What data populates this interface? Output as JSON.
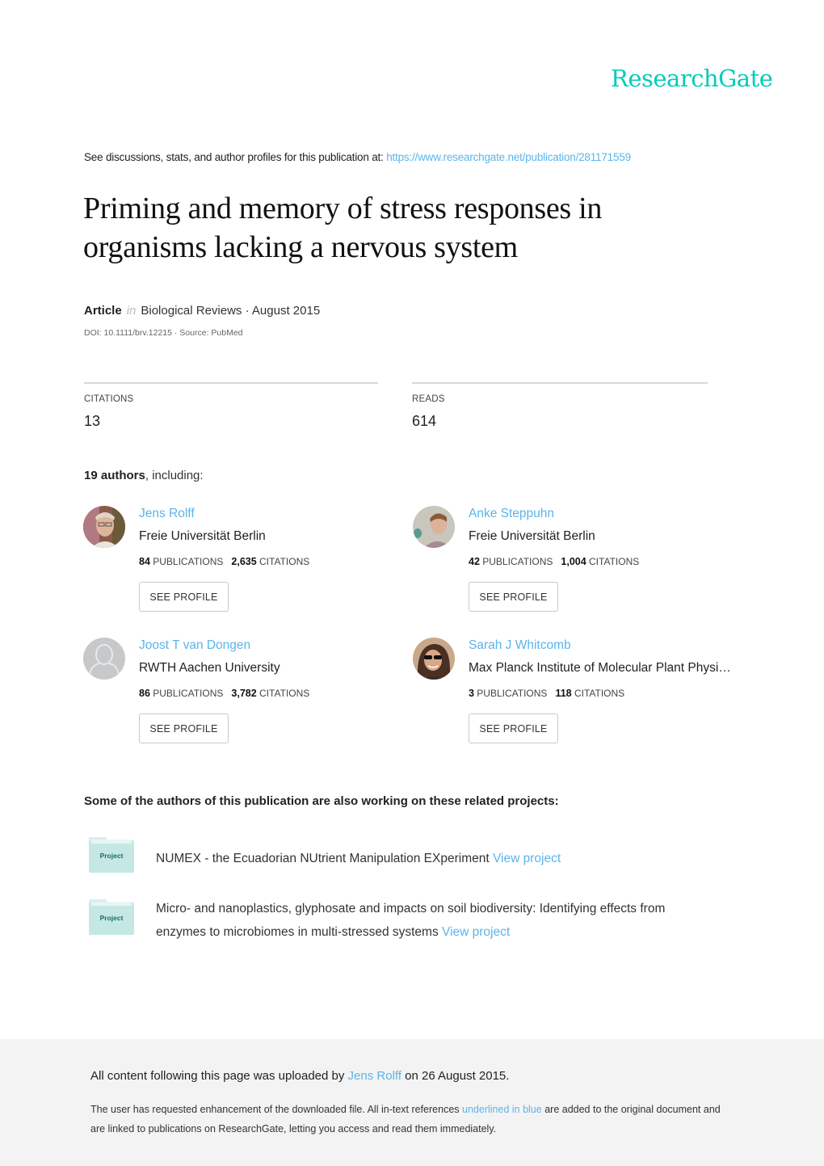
{
  "brand": {
    "logo_text": "ResearchGate",
    "accent_color": "#00ccbb",
    "link_color": "#5bb4ea"
  },
  "header": {
    "see_discussions_text": "See discussions, stats, and author profiles for this publication at:",
    "publication_url": "https://www.researchgate.net/publication/281171559"
  },
  "publication": {
    "title": "Priming and memory of stress responses in organisms lacking a nervous system",
    "type": "Article",
    "in_word": "in",
    "journal_date": "Biological Reviews · August 2015",
    "doi_source": "DOI: 10.1111/brv.12215 · Source: PubMed"
  },
  "stats": {
    "citations_label": "CITATIONS",
    "citations_value": "13",
    "reads_label": "READS",
    "reads_value": "614"
  },
  "authors_section": {
    "count_bold": "19 authors",
    "count_rest": ", including:",
    "authors": [
      {
        "name": "Jens Rolff",
        "institution": "Freie Universität Berlin",
        "publications": "84",
        "publications_label": "PUBLICATIONS",
        "citations": "2,635",
        "citations_label": "CITATIONS",
        "button": "SEE PROFILE",
        "avatar": "photo"
      },
      {
        "name": "Anke Steppuhn",
        "institution": "Freie Universität Berlin",
        "publications": "42",
        "publications_label": "PUBLICATIONS",
        "citations": "1,004",
        "citations_label": "CITATIONS",
        "button": "SEE PROFILE",
        "avatar": "photo"
      },
      {
        "name": "Joost T van Dongen",
        "institution": "RWTH Aachen University",
        "publications": "86",
        "publications_label": "PUBLICATIONS",
        "citations": "3,782",
        "citations_label": "CITATIONS",
        "button": "SEE PROFILE",
        "avatar": "placeholder"
      },
      {
        "name": "Sarah J Whitcomb",
        "institution": "Max Planck Institute of Molecular Plant Physi…",
        "publications": "3",
        "publications_label": "PUBLICATIONS",
        "citations": "118",
        "citations_label": "CITATIONS",
        "button": "SEE PROFILE",
        "avatar": "photo"
      }
    ]
  },
  "projects_section": {
    "heading": "Some of the authors of this publication are also working on these related projects:",
    "icon_label": "Project",
    "projects": [
      {
        "title": "NUMEX - the Ecuadorian NUtrient Manipulation EXperiment",
        "link": "View project"
      },
      {
        "title": "Micro- and nanoplastics, glyphosate and impacts on soil biodiversity: Identifying effects from enzymes to microbiomes in multi-stressed systems",
        "link": "View project"
      }
    ]
  },
  "footer": {
    "uploaded_prefix": "All content following this page was uploaded by",
    "uploader": "Jens Rolff",
    "uploaded_suffix": "on 26 August 2015.",
    "enhance_prefix": "The user has requested enhancement of the downloaded file. All in-text references",
    "enhance_link": "underlined in blue",
    "enhance_suffix": "are added to the original document and are linked to publications on ResearchGate, letting you access and read them immediately."
  }
}
